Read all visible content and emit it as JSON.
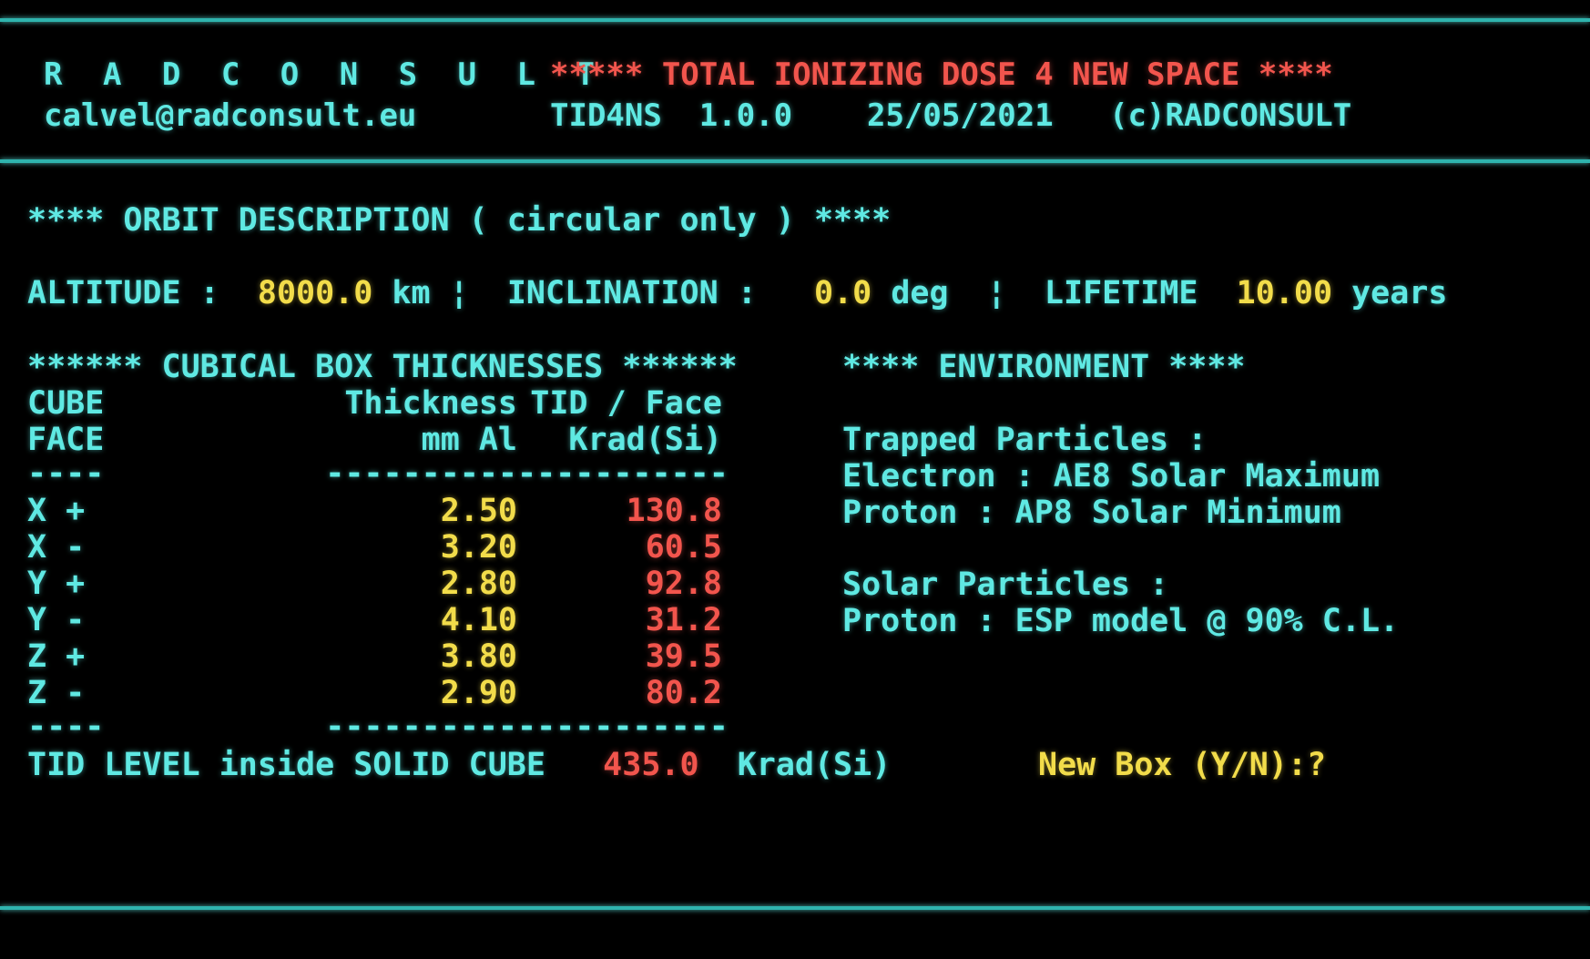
{
  "colors": {
    "background": "#000000",
    "label_cyan": "#5fe9e3",
    "value_yellow": "#f2dc4a",
    "result_red": "#f2554d",
    "rule": "#2fb4ae"
  },
  "header": {
    "brand_name": "R A D C O N S U L T",
    "brand_email": "calvel@radconsult.eu",
    "app_banner": "***** TOTAL IONIZING DOSE 4 NEW SPACE ****",
    "app_name": "TID4NS",
    "app_version": "1.0.0",
    "app_date": "25/05/2021",
    "app_copyright": "(c)RADCONSULT",
    "app_version_line": "TID4NS  1.0.0    25/05/2021   (c)RADCONSULT"
  },
  "orbit": {
    "heading": "**** ORBIT DESCRIPTION ( circular only ) ****",
    "altitude_label": "ALTITUDE :",
    "altitude_value": "8000.0",
    "altitude_unit": "km",
    "separator": "¦",
    "inclination_label": "INCLINATION :",
    "inclination_value": "0.0",
    "inclination_unit": "deg",
    "lifetime_label": "LIFETIME",
    "lifetime_value": "10.00",
    "lifetime_unit": "years"
  },
  "box": {
    "heading": "****** CUBICAL BOX THICKNESSES ******",
    "header_row_1": {
      "face": "CUBE",
      "thickness": "Thickness",
      "tid": "TID / Face"
    },
    "header_row_2": {
      "face": "FACE",
      "thickness": "mm Al",
      "tid": "Krad(Si)"
    },
    "sep_face": "----",
    "sep_thickness": "----------",
    "sep_tid": "-----------",
    "rows": [
      {
        "face": "X +",
        "thickness": "2.50",
        "tid": "130.8"
      },
      {
        "face": "X -",
        "thickness": "3.20",
        "tid": "60.5"
      },
      {
        "face": "Y +",
        "thickness": "2.80",
        "tid": "92.8"
      },
      {
        "face": "Y -",
        "thickness": "4.10",
        "tid": "31.2"
      },
      {
        "face": "Z +",
        "thickness": "3.80",
        "tid": "39.5"
      },
      {
        "face": "Z -",
        "thickness": "2.90",
        "tid": "80.2"
      }
    ],
    "total_label": "TID LEVEL inside SOLID CUBE",
    "total_value": "435.0",
    "total_unit": "Krad(Si)"
  },
  "environment": {
    "heading": "**** ENVIRONMENT ****",
    "trapped_title": "Trapped Particles :",
    "trapped_electron": "Electron : AE8 Solar Maximum",
    "trapped_proton": "Proton : AP8 Solar Minimum",
    "solar_title": "Solar Particles :",
    "solar_proton": "Proton : ESP model @ 90% C.L."
  },
  "prompt": {
    "new_box": "New Box (Y/N):?"
  }
}
